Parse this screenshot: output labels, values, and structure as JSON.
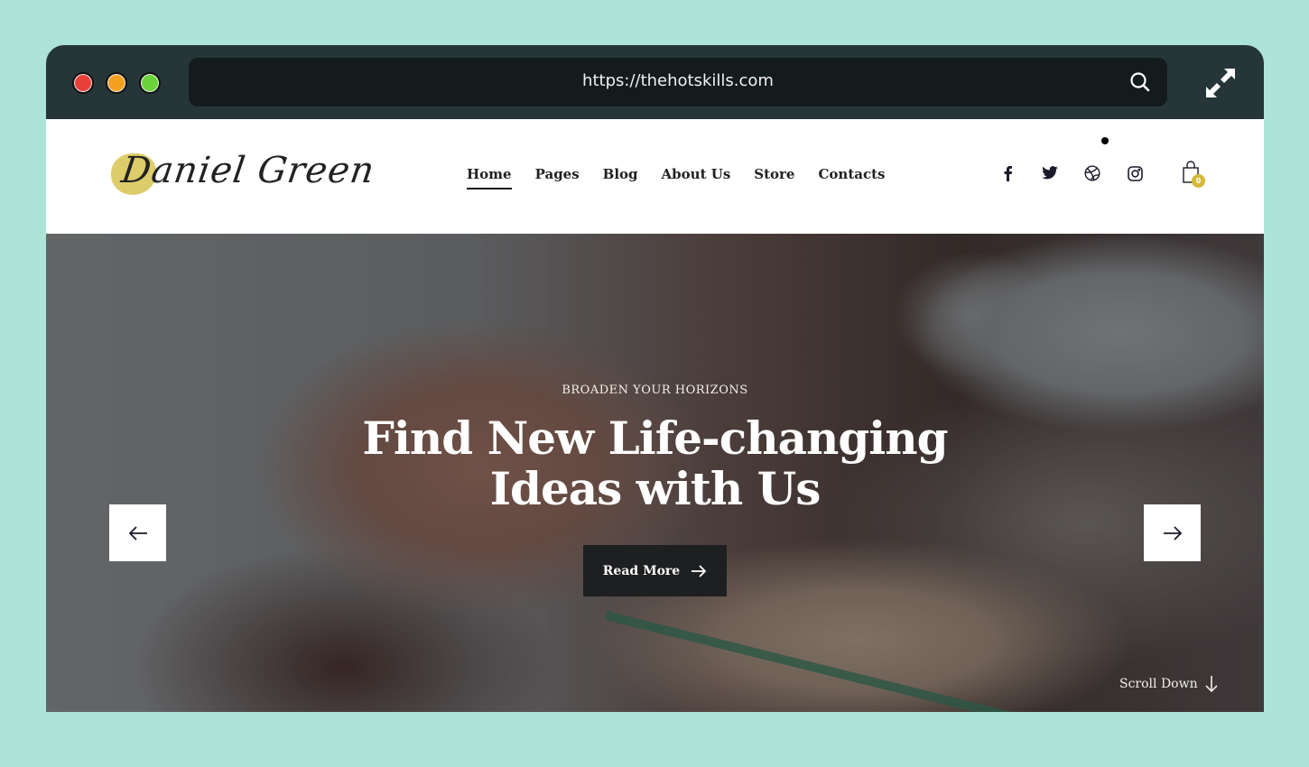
{
  "browser": {
    "url": "https://thehotskills.com",
    "window_controls": [
      "close",
      "minimize",
      "maximize"
    ],
    "search_icon": "search-icon",
    "expand_icon": "expand-icon"
  },
  "header": {
    "logo_text": "Daniel Green",
    "nav": [
      {
        "label": "Home",
        "active": true
      },
      {
        "label": "Pages",
        "active": false
      },
      {
        "label": "Blog",
        "active": false
      },
      {
        "label": "About Us",
        "active": false
      },
      {
        "label": "Store",
        "active": false
      },
      {
        "label": "Contacts",
        "active": false
      }
    ],
    "socials": [
      "facebook-icon",
      "twitter-icon",
      "dribbble-icon",
      "instagram-icon"
    ],
    "cart": {
      "icon": "shopping-bag-icon",
      "count": "0",
      "badge_color": "#d4b93a"
    }
  },
  "hero": {
    "eyebrow": "BROADEN YOUR HORIZONS",
    "title_line1": "Find New Life-changing",
    "title_line2": "Ideas with Us",
    "cta_label": "Read More",
    "prev_icon": "arrow-left-icon",
    "next_icon": "arrow-right-icon",
    "scroll_label": "Scroll Down"
  },
  "colors": {
    "page_background": "#ade4d8",
    "chrome": "#263638",
    "urlbar": "#141b1c",
    "accent": "#d9c65a",
    "button_dark": "#1e1f21"
  }
}
